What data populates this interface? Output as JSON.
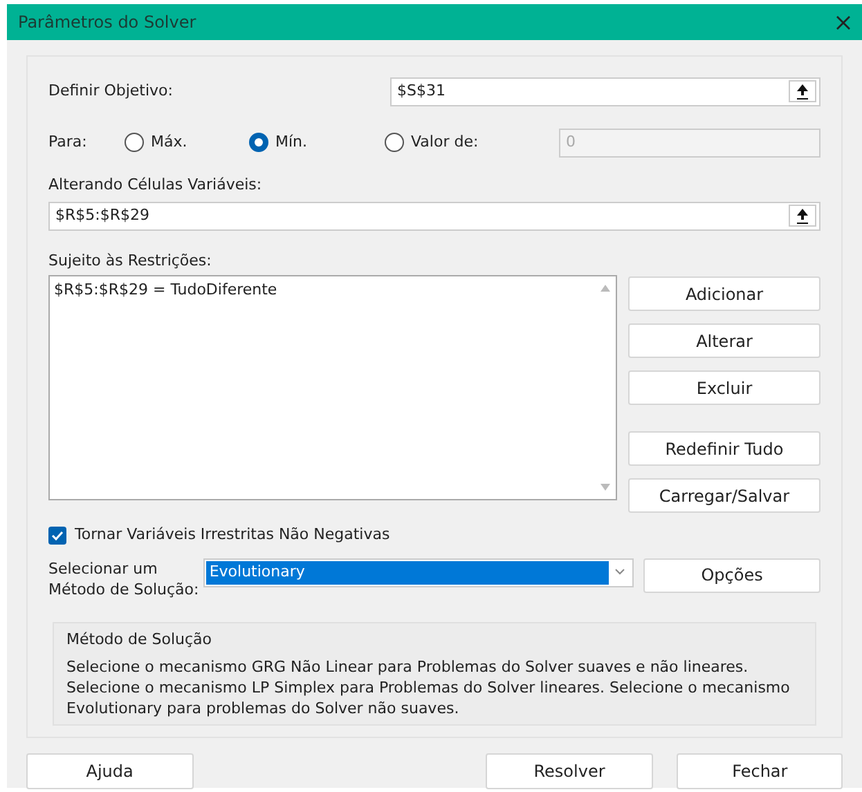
{
  "window": {
    "title": "Parâmetros do Solver"
  },
  "objective": {
    "label": "Definir Objetivo:",
    "value": "$S$31"
  },
  "target": {
    "label": "Para:",
    "options": [
      {
        "label": "Máx.",
        "selected": false
      },
      {
        "label": "Mín.",
        "selected": true
      },
      {
        "label": "Valor de:",
        "selected": false
      }
    ],
    "value": "0"
  },
  "variables": {
    "label": "Alterando Células Variáveis:",
    "value": "$R$5:$R$29"
  },
  "constraints": {
    "label": "Sujeito às Restrições:",
    "items": [
      "$R$5:$R$29 = TudoDiferente"
    ],
    "buttons": [
      "Adicionar",
      "Alterar",
      "Excluir",
      "Redefinir Tudo",
      "Carregar/Salvar"
    ]
  },
  "nonnegative": {
    "label": "Tornar Variáveis Irrestritas Não Negativas",
    "checked": true
  },
  "method": {
    "label_lines": [
      "Selecionar um",
      "Método de Solução:"
    ],
    "value": "Evolutionary",
    "options_button": "Opções"
  },
  "method_info": {
    "title": "Método de Solução",
    "text": "Selecione o mecanismo GRG Não Linear para Problemas do Solver suaves e não lineares. Selecione o mecanismo LP Simplex para Problemas do Solver lineares. Selecione o mecanismo Evolutionary para problemas do Solver não suaves."
  },
  "footer": {
    "buttons": [
      {
        "label": "Ajuda",
        "kind": "help"
      },
      {
        "label": "Resolver",
        "kind": "default"
      },
      {
        "label": "Fechar",
        "kind": "close"
      }
    ]
  }
}
